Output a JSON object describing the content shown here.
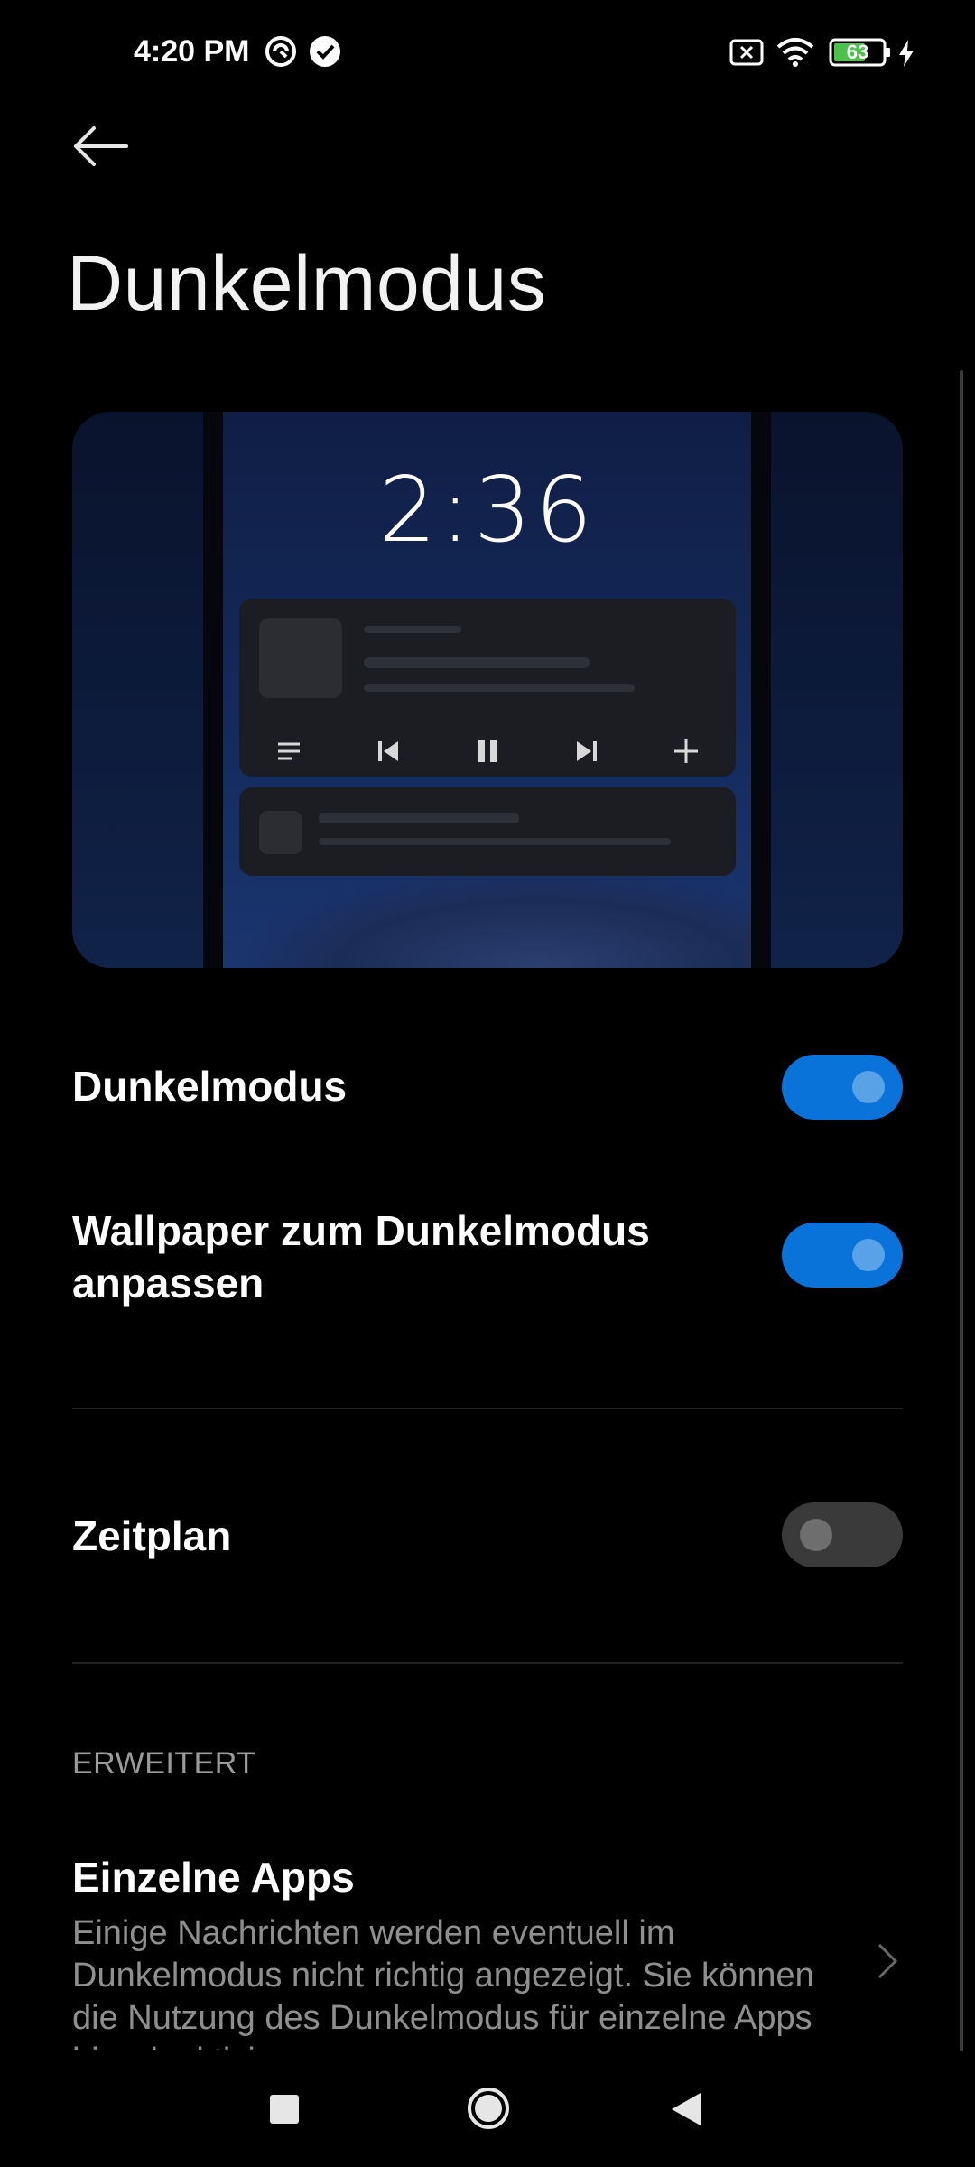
{
  "status_bar": {
    "time": "4:20 PM",
    "battery_level": "63",
    "icons": [
      "vpn-icon",
      "check-circle-icon",
      "sim-x-icon",
      "wifi-icon",
      "battery-icon",
      "charging-bolt-icon"
    ]
  },
  "header": {
    "back_icon": "arrow-left-icon",
    "title": "Dunkelmodus"
  },
  "preview": {
    "clock": "2:36",
    "controls": [
      "menu-icon",
      "previous-icon",
      "pause-icon",
      "next-icon",
      "plus-icon"
    ]
  },
  "settings": {
    "dark_mode": {
      "label": "Dunkelmodus",
      "enabled": true
    },
    "wallpaper": {
      "label_line1": "Wallpaper zum Dunkelmodus",
      "label_line2": "anpassen",
      "enabled": true
    },
    "schedule": {
      "label": "Zeitplan",
      "enabled": false
    }
  },
  "advanced": {
    "section_title": "ERWEITERT",
    "individual_apps": {
      "title": "Einzelne Apps",
      "description": "Einige Nachrichten werden eventuell im Dunkelmodus nicht richtig angezeigt. Sie können die Nutzung des Dunkelmodus für einzelne Apps hier deaktivieren."
    }
  },
  "colors": {
    "accent": "#0a73d9",
    "background": "#000000",
    "toggle_off": "#3a3a3a"
  },
  "nav_bar": {
    "buttons": [
      "recents-icon",
      "home-icon",
      "back-triangle-icon"
    ]
  }
}
